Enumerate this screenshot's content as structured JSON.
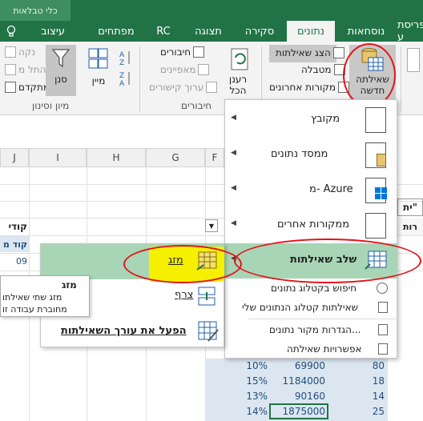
{
  "context_tab": "כלי טבלאות",
  "tabs": [
    "עיצוב",
    "מפתחים",
    "RC",
    "תצוגה",
    "סקירה",
    "נתונים",
    "נוסחאות",
    "פריסת ע"
  ],
  "selected_tab": "נתונים",
  "light_icon": "lightbulb-icon",
  "ribbon": {
    "new_query": "שאילתה\nחדשה",
    "show_queries": "הצג שאילתות",
    "from_table": "מטבלה",
    "recent_sources": "מקורות אחרונים",
    "refresh_all": "רענן\nהכל",
    "connections": "חיבורים",
    "properties": "מאפיינים",
    "edit_links": "ערוך קישורים",
    "connections_group": "חיבורים",
    "sort_az_za": "מיין",
    "filter": "סנן",
    "clear": "נקה",
    "reapply": "החל מ",
    "advanced": "מתקדם",
    "sort_filter_group": "מיון וסינון"
  },
  "columns": [
    "J",
    "I",
    "H",
    "G",
    "F"
  ],
  "cells_left": [
    "קודי",
    "קוד מ",
    "09"
  ],
  "tooltip": {
    "title": "מזג",
    "line1": "מזג שתי שאילתו",
    "line2": "מחוברת עבודה זו"
  },
  "submenu": {
    "merge": "מזג",
    "append": "צרף",
    "launch_editor": "הפעל את עורך השאילתות"
  },
  "menu": {
    "from_file": "מקובץ",
    "from_database": "ממסד נתונים",
    "from_azure": "מ- Azure",
    "from_other": "ממקורות אחרים",
    "combine": "שלב שאילתות",
    "search_catalog": "חיפוש בקטלוג נתונים",
    "my_catalog": "שאילתות קטלוג הנתונים שלי",
    "data_source_settings": "הגדרות מקור נתונים...",
    "query_options": "אפשרויות שאילתה"
  },
  "right_header": "ית\"",
  "right_header2": "רות",
  "table_rows": [
    {
      "pct": "10%",
      "val": "69900",
      "n": "80"
    },
    {
      "pct": "15%",
      "val": "1184000",
      "n": "18"
    },
    {
      "pct": "13%",
      "val": "90160",
      "n": "14"
    },
    {
      "pct": "14%",
      "val": "1875000",
      "n": "25"
    }
  ],
  "colors": {
    "excel_green": "#217346",
    "menu_highlight": "#a8d5b5",
    "yellow_mark": "#f4f000",
    "red_mark": "#e3141b"
  }
}
